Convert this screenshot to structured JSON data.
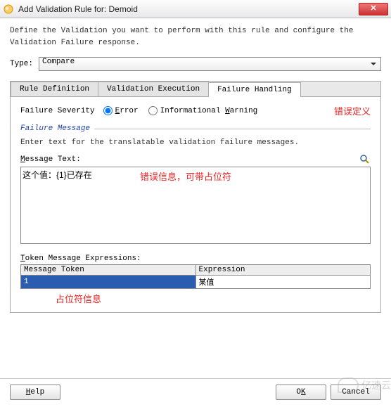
{
  "titlebar": {
    "title": "Add Validation Rule for: Demoid"
  },
  "description": "Define the Validation you want to perform with this rule and configure the Validation Failure response.",
  "type": {
    "label": "Type:",
    "value": "Compare"
  },
  "tabs": {
    "rule_def": "Rule Definition",
    "val_exec": "Validation Execution",
    "fail_hand": "Failure Handling"
  },
  "severity": {
    "label": "Failure Severity",
    "error": "Error",
    "informational": "Informational Warning",
    "selected": "error"
  },
  "annotations": {
    "err_def": "错误定义",
    "msg_hint": "错误信息，可带占位符",
    "token_hint": "占位符信息"
  },
  "failure_message": {
    "group": "Failure Message",
    "hint": "Enter text for the translatable validation failure messages.",
    "label": "Message Text:",
    "value": "这个值：{1}已存在"
  },
  "token": {
    "label": "Token Message Expressions:",
    "cols": {
      "token": "Message Token",
      "expr": "Expression"
    },
    "rows": [
      {
        "token": "1",
        "expr": "某值"
      }
    ]
  },
  "buttons": {
    "help": "Help",
    "ok": "OK",
    "cancel": "Cancel"
  },
  "watermark": "亿速云"
}
